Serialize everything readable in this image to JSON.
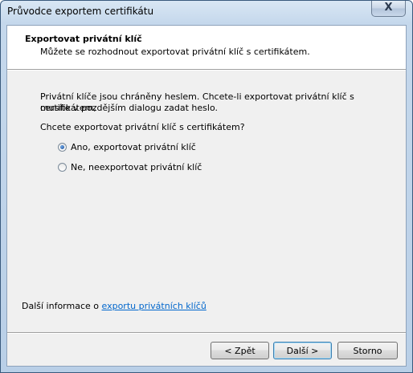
{
  "window": {
    "title": "Průvodce exportem certifikátu",
    "close_label": "X"
  },
  "header": {
    "title": "Exportovat privátní klíč",
    "subtitle": "Můžete se rozhodnout exportovat privátní klíč s certifikátem."
  },
  "body": {
    "info_line1": "Privátní klíče jsou chráněny heslem. Chcete-li exportovat privátní klíč s certifikátem,",
    "info_line2": "musíte v pozdějším dialogu zadat heslo.",
    "question": "Chcete exportovat privátní klíč s certifikátem?",
    "options": [
      {
        "label": "Ano, exportovat privátní klíč",
        "checked": true
      },
      {
        "label": "Ne, neexportovat privátní klíč",
        "checked": false
      }
    ]
  },
  "footer_info": {
    "prefix": "Další informace o ",
    "link_text": "exportu privátních klíčů"
  },
  "buttons": {
    "back": "< Zpět",
    "next": "Další >",
    "cancel": "Storno"
  }
}
